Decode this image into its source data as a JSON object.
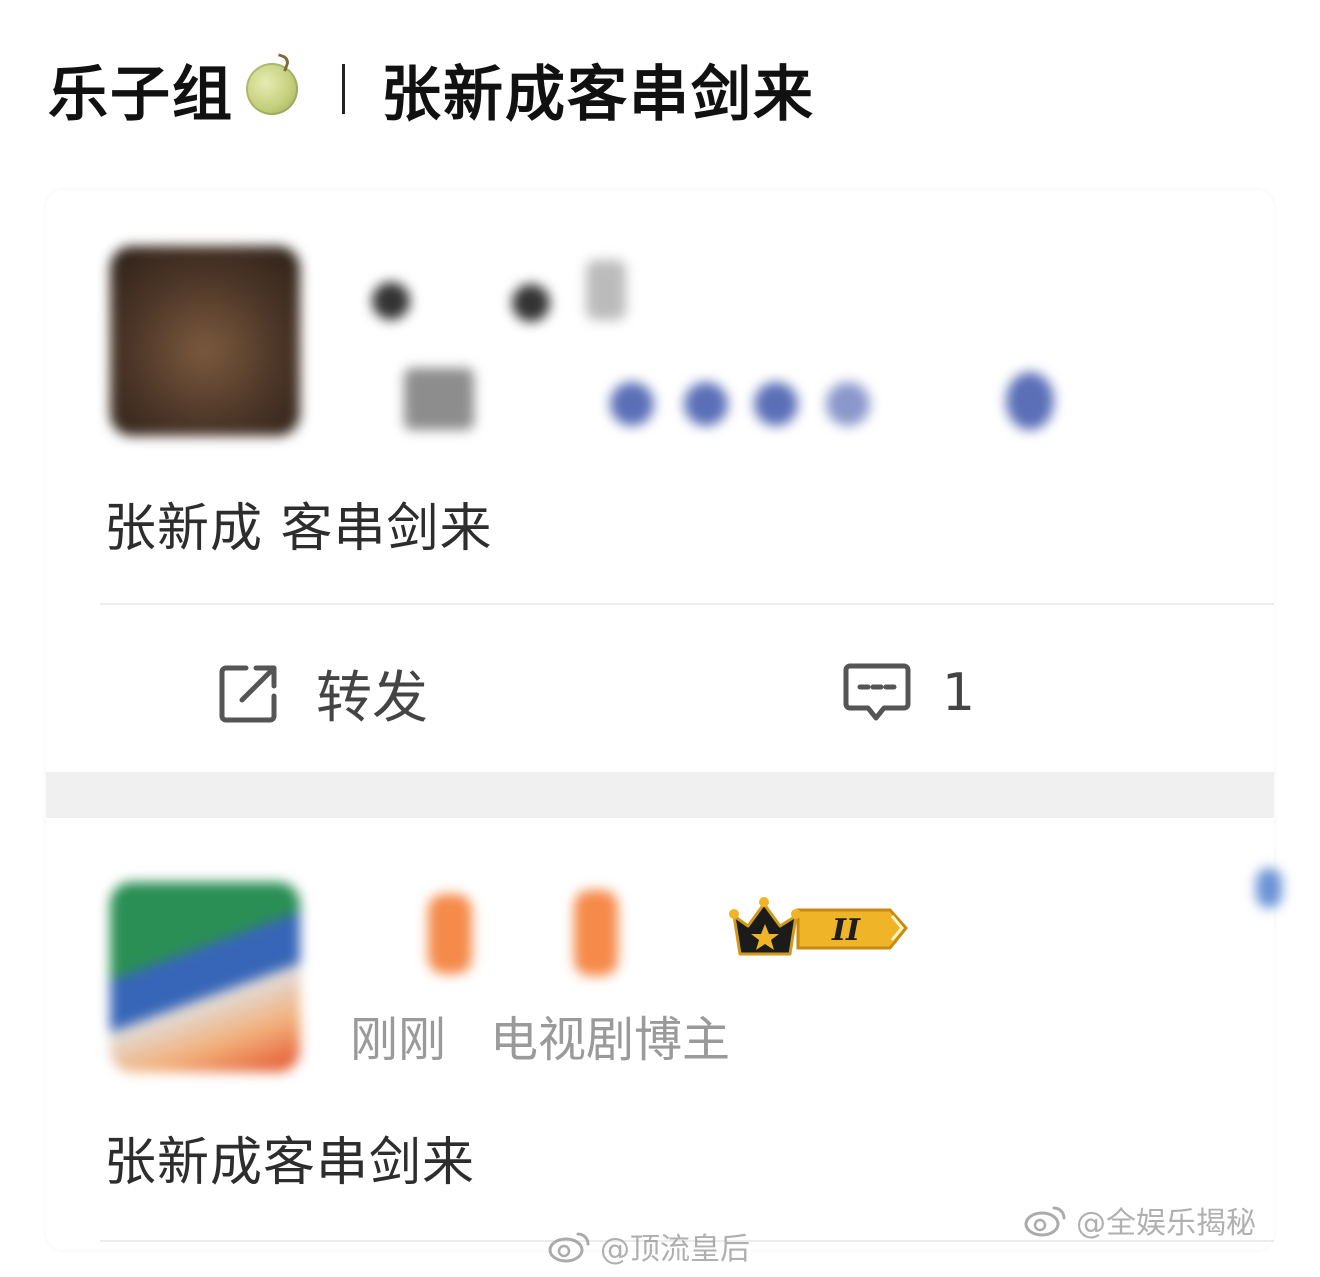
{
  "header": {
    "left_title": "乐子组",
    "melon_icon": "melon-icon",
    "right_title": "张新成客串剑来"
  },
  "post_1": {
    "content": "张新成 客串剑来",
    "actions": {
      "share_label": "转发",
      "comment_count": "1"
    }
  },
  "post_2": {
    "time": "刚刚",
    "role": "电视剧博主",
    "badge_text": "II",
    "content": "张新成客串剑来"
  },
  "watermarks": {
    "top": "@全娱乐揭秘",
    "bottom": "@顶流皇后"
  },
  "colors": {
    "badge_gold": "#f0b429",
    "blur_blue": "#5b6fb8",
    "blur_orange": "#f58a4a",
    "separator": "#f0f0f0"
  }
}
